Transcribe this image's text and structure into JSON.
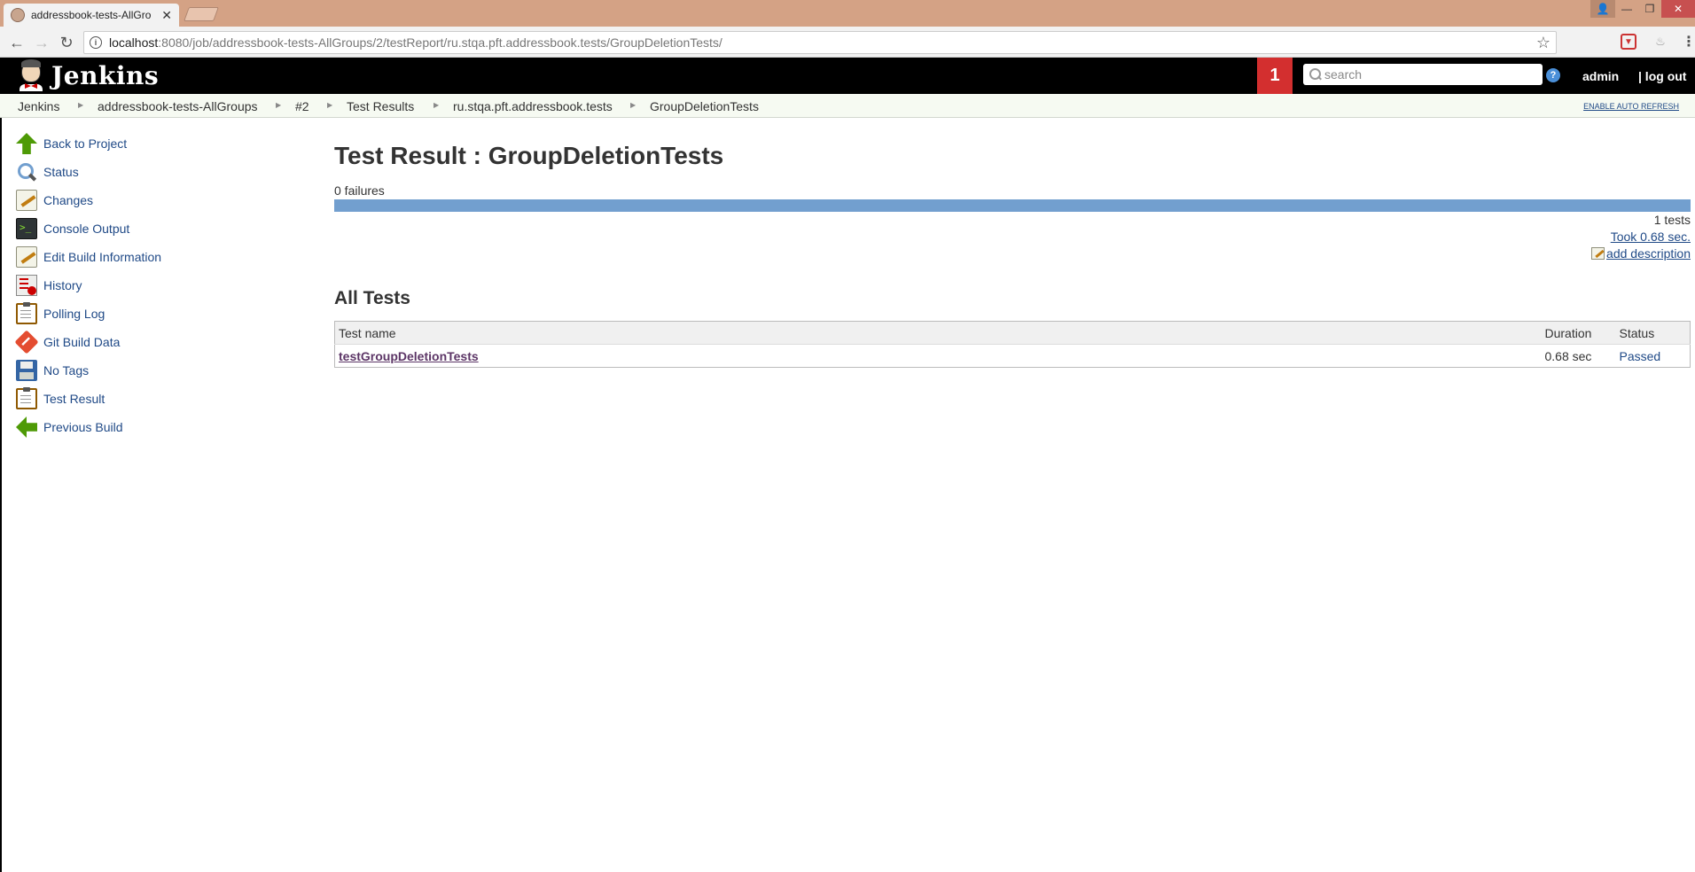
{
  "browser": {
    "tab_title": "addressbook-tests-AllGro",
    "url_host": "localhost",
    "url_rest": ":8080/job/addressbook-tests-AllGroups/2/testReport/ru.stqa.pft.addressbook.tests/GroupDeletionTests/"
  },
  "header": {
    "title": "Jenkins",
    "notification_count": "1",
    "search_placeholder": "search",
    "user": "admin",
    "logout": "| log out"
  },
  "breadcrumbs": [
    "Jenkins",
    "addressbook-tests-AllGroups",
    "#2",
    "Test Results",
    "ru.stqa.pft.addressbook.tests",
    "GroupDeletionTests"
  ],
  "auto_refresh": "ENABLE AUTO REFRESH",
  "sidebar": {
    "items": [
      {
        "label": "Back to Project",
        "icon": "up-arrow-icon"
      },
      {
        "label": "Status",
        "icon": "magnifier-icon"
      },
      {
        "label": "Changes",
        "icon": "notepad-icon"
      },
      {
        "label": "Console Output",
        "icon": "terminal-icon"
      },
      {
        "label": "Edit Build Information",
        "icon": "notepad-icon"
      },
      {
        "label": "History",
        "icon": "history-icon"
      },
      {
        "label": "Polling Log",
        "icon": "clipboard-icon"
      },
      {
        "label": "Git Build Data",
        "icon": "git-icon"
      },
      {
        "label": "No Tags",
        "icon": "floppy-icon"
      },
      {
        "label": "Test Result",
        "icon": "clipboard-icon"
      },
      {
        "label": "Previous Build",
        "icon": "left-arrow-icon"
      }
    ]
  },
  "main": {
    "title": "Test Result : GroupDeletionTests",
    "failures": "0 failures",
    "tests_count": "1 tests",
    "took": "Took 0.68 sec.",
    "add_description": "add description",
    "all_tests_heading": "All Tests",
    "table": {
      "headers": [
        "Test name",
        "Duration",
        "Status"
      ],
      "rows": [
        {
          "name": "testGroupDeletionTests",
          "duration": "0.68 sec",
          "status": "Passed"
        }
      ]
    }
  },
  "colors": {
    "header_bg": "#000000",
    "notification_bg": "#d32f2f",
    "progress_bar": "#729fcf",
    "link": "#204a87",
    "visited_link": "#5c3566"
  }
}
